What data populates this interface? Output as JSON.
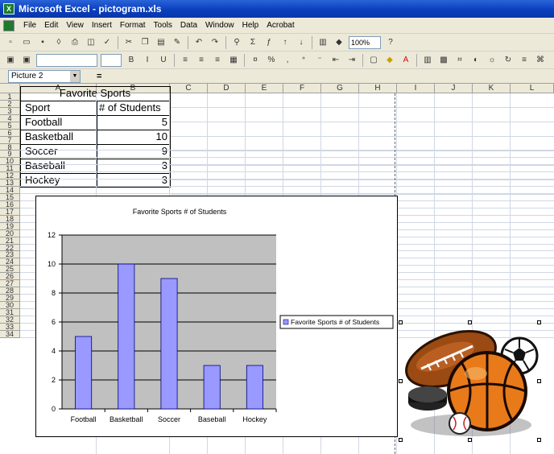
{
  "window": {
    "title": "Microsoft Excel - pictogram.xls"
  },
  "menu": [
    "File",
    "Edit",
    "View",
    "Insert",
    "Format",
    "Tools",
    "Data",
    "Window",
    "Help",
    "Acrobat"
  ],
  "toolbar": {
    "zoom": "100%"
  },
  "formula_bar": {
    "name_box": "Picture 2",
    "equals": "="
  },
  "columns": [
    "A",
    "B",
    "C",
    "D",
    "E",
    "F",
    "G",
    "H",
    "I",
    "J",
    "K",
    "L"
  ],
  "rows": [
    "1",
    "2",
    "3",
    "4",
    "5",
    "6",
    "7",
    "8",
    "9",
    "10",
    "11",
    "12",
    "13",
    "14",
    "15",
    "16",
    "17",
    "18",
    "19",
    "20",
    "21",
    "22",
    "23",
    "24",
    "25",
    "26",
    "27",
    "28",
    "29",
    "30",
    "31",
    "32",
    "33",
    "34"
  ],
  "table": {
    "title": "Favorite Sports",
    "header": [
      "Sport",
      "# of Students"
    ],
    "rows": [
      [
        "Football",
        "5"
      ],
      [
        "Basketball",
        "10"
      ],
      [
        "Soccer",
        "9"
      ],
      [
        "Baseball",
        "3"
      ],
      [
        "Hockey",
        "3"
      ]
    ]
  },
  "chart_data": {
    "type": "bar",
    "title": "Favorite Sports # of Students",
    "categories": [
      "Football",
      "Basketball",
      "Soccer",
      "Baseball",
      "Hockey"
    ],
    "series": [
      {
        "name": "Favorite Sports # of Students",
        "values": [
          5,
          10,
          9,
          3,
          3
        ]
      }
    ],
    "ylim": [
      0,
      12
    ],
    "yticks": [
      0,
      2,
      4,
      6,
      8,
      10,
      12
    ],
    "legend": "right",
    "grid": true,
    "colors": {
      "bar": "#9999ff",
      "plot_bg": "#c0c0c0",
      "bar_edge": "#000080"
    }
  },
  "clipart": {
    "icon": "sports-balls-clipart"
  }
}
